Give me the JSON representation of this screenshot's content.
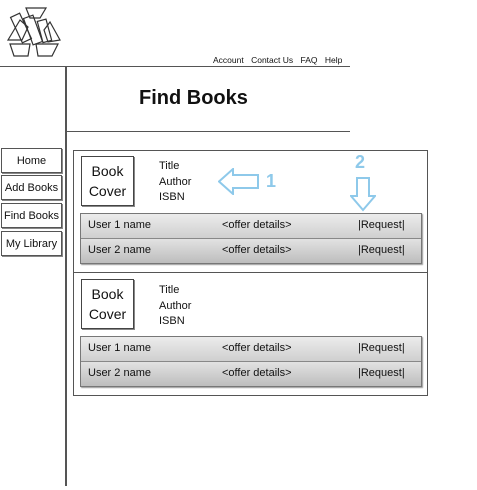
{
  "header": {
    "nav": [
      "Account",
      "Contact Us",
      "FAQ",
      "Help"
    ],
    "title": "Find Books"
  },
  "sidebar": {
    "items": [
      {
        "label": "Home"
      },
      {
        "label": "Add Books"
      },
      {
        "label": "Find Books"
      },
      {
        "label": "My Library"
      }
    ]
  },
  "results": [
    {
      "cover": [
        "Book",
        "Cover"
      ],
      "meta": [
        "Title",
        "Author",
        "ISBN"
      ],
      "offers": [
        {
          "user": "User 1 name",
          "details": "<offer details>",
          "action": "|Request|"
        },
        {
          "user": "User 2 name",
          "details": "<offer details>",
          "action": "|Request|"
        }
      ]
    },
    {
      "cover": [
        "Book",
        "Cover"
      ],
      "meta": [
        "Title",
        "Author",
        "ISBN"
      ],
      "offers": [
        {
          "user": "User 1 name",
          "details": "<offer details>",
          "action": "|Request|"
        },
        {
          "user": "User 2 name",
          "details": "<offer details>",
          "action": "|Request|"
        }
      ]
    }
  ],
  "annotations": {
    "one": "1",
    "two": "2"
  },
  "icons": {
    "logo": "recycle-books-icon",
    "left_arrow": "arrow-left-icon",
    "down_arrow": "arrow-down-icon"
  },
  "colors": {
    "annotation": "#8ec9ea"
  }
}
